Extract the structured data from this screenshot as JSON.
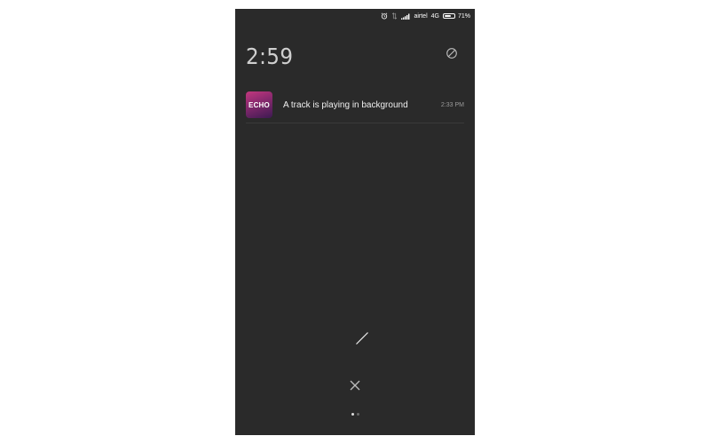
{
  "status_bar": {
    "carrier": "airtel",
    "network": "4G",
    "battery_percent_label": "71%",
    "battery_level": 0.71,
    "icons": [
      "alarm-icon",
      "data-arrows-icon",
      "signal-icon",
      "battery-icon"
    ]
  },
  "header": {
    "time": "2:59",
    "dnd_icon": "do-not-disturb-icon"
  },
  "notifications": [
    {
      "app_icon_text": "ECHO",
      "message": "A track is playing in background",
      "time": "2:33 PM"
    }
  ],
  "controls": {
    "clear_icon": "close-icon",
    "edit_icon": "slash-icon"
  },
  "pager": {
    "pages": 2,
    "active": 0
  },
  "colors": {
    "background": "#2a2a2a",
    "app_icon_accent": "#c2387e"
  }
}
